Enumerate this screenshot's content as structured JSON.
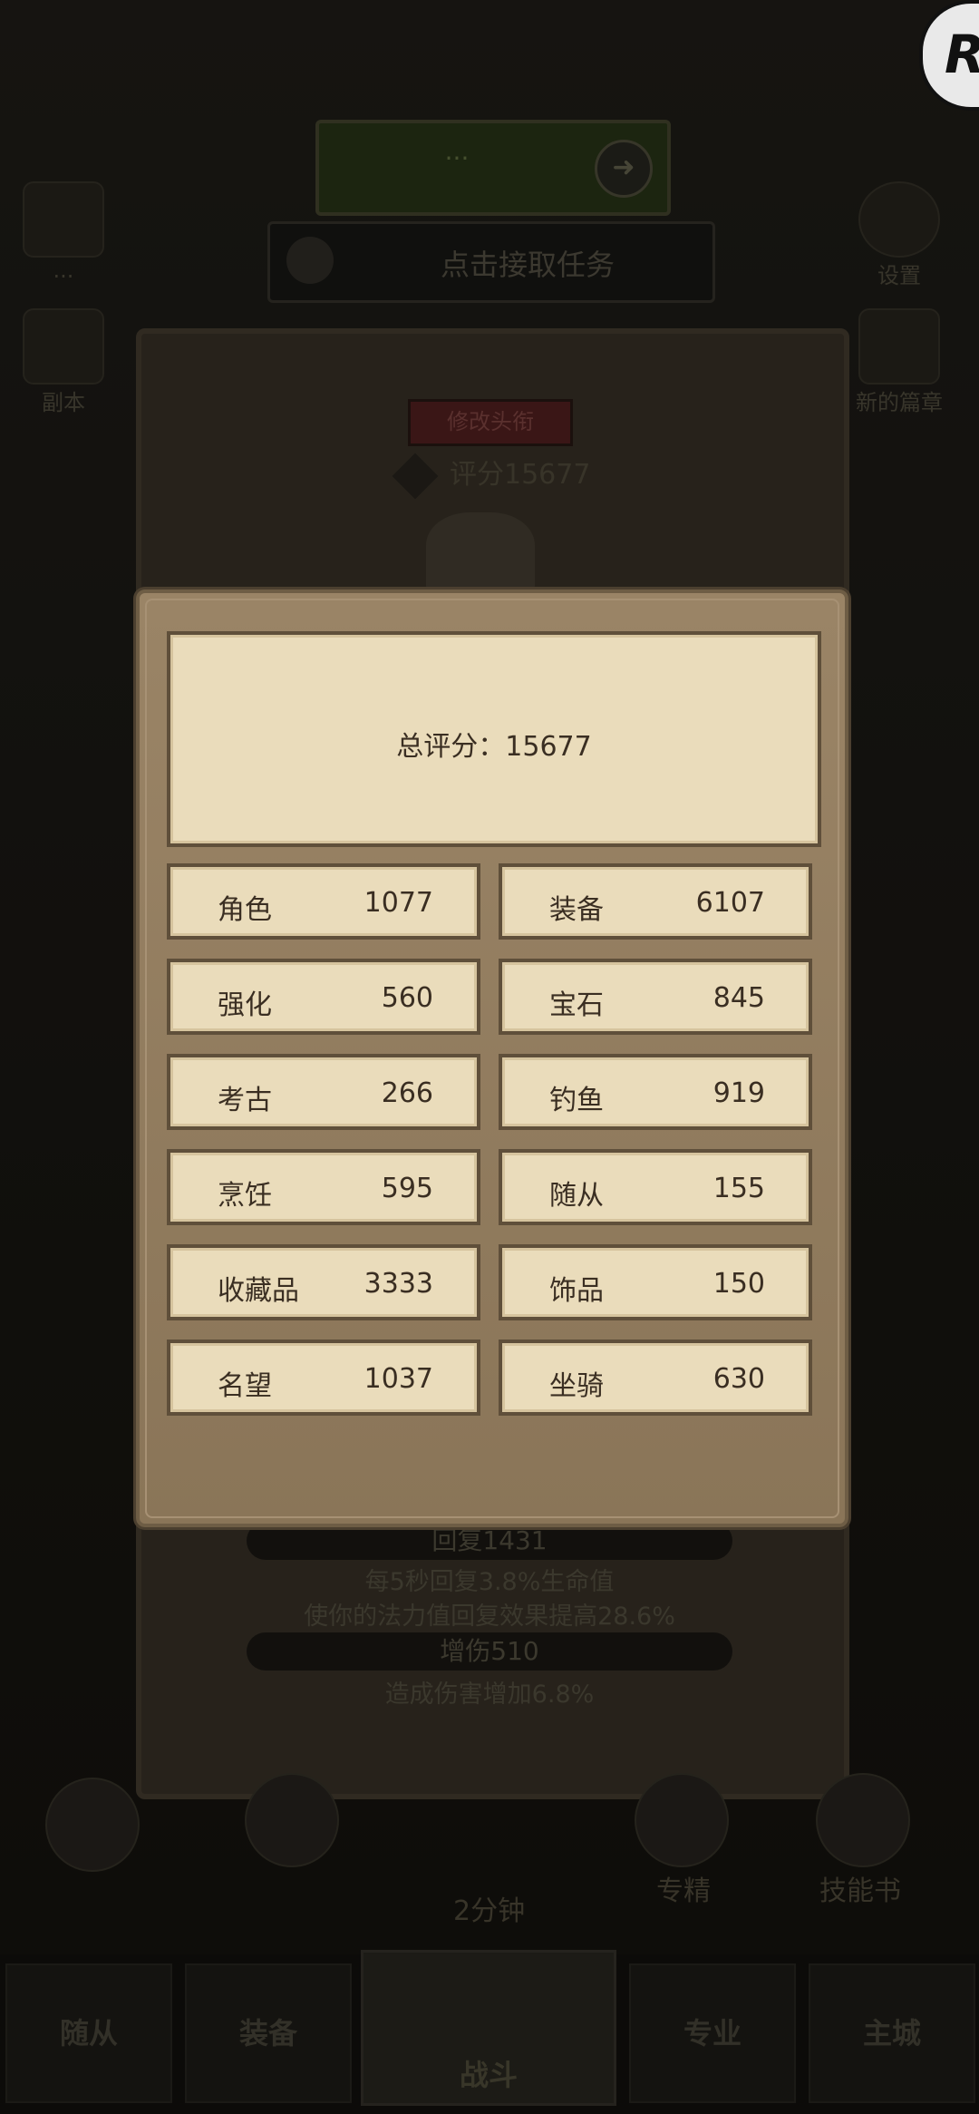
{
  "background": {
    "quest_title": "...",
    "task_prompt": "点击接取任务",
    "left_icons": [
      {
        "label": "..."
      },
      {
        "label": "副本"
      }
    ],
    "right_icons": [
      {
        "label": "设置"
      },
      {
        "label": "新的篇章"
      }
    ],
    "rename_button": "修改头衔",
    "score_text": "评分15677",
    "stat_bars": [
      "回复1431",
      "增伤510"
    ],
    "stat_lines": [
      "每5秒回复3.8%生命值",
      "使你的法力值回复效果提高28.6%",
      "造成伤害增加6.8%"
    ],
    "mid_labels": {
      "timer": "2分钟",
      "special": "专精",
      "skillbook": "技能书"
    },
    "bottom_nav": [
      "随从",
      "装备",
      "战斗",
      "专业",
      "主城"
    ]
  },
  "dialog": {
    "total": "总评分：15677",
    "stats": [
      {
        "label": "角色",
        "value": "1077"
      },
      {
        "label": "装备",
        "value": "6107"
      },
      {
        "label": "强化",
        "value": "560"
      },
      {
        "label": "宝石",
        "value": "845"
      },
      {
        "label": "考古",
        "value": "266"
      },
      {
        "label": "钓鱼",
        "value": "919"
      },
      {
        "label": "烹饪",
        "value": "595"
      },
      {
        "label": "随从",
        "value": "155"
      },
      {
        "label": "收藏品",
        "value": "3333"
      },
      {
        "label": "饰品",
        "value": "150"
      },
      {
        "label": "名望",
        "value": "1037"
      },
      {
        "label": "坐骑",
        "value": "630"
      }
    ]
  },
  "corner_logo_letter": "R",
  "icons": {
    "quest_arrow": "arrow-right-icon",
    "help": "question-icon"
  }
}
